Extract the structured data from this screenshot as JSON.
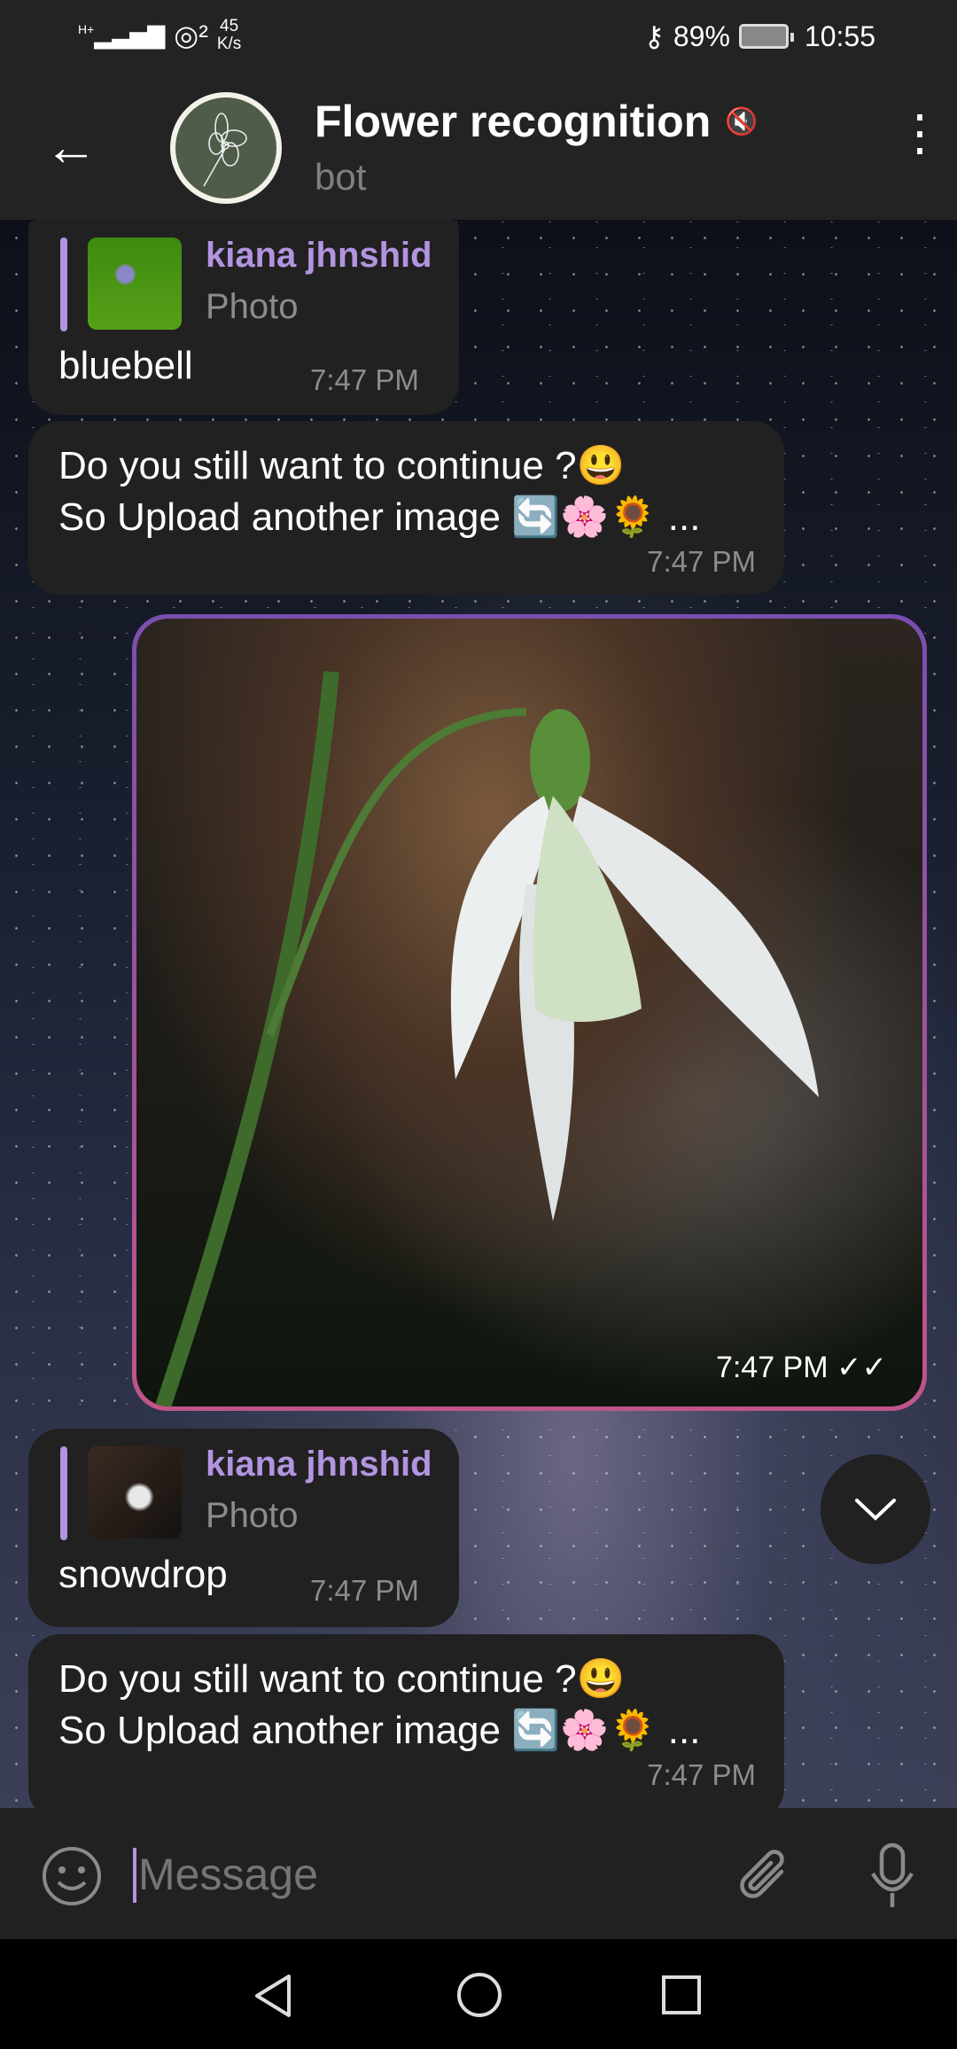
{
  "status_bar": {
    "network": "H+",
    "speed_value": "45",
    "speed_unit": "K/s",
    "battery": "89%",
    "time": "10:55"
  },
  "header": {
    "title": "Flower recognition",
    "subtitle": "bot"
  },
  "messages": [
    {
      "type": "reply",
      "sender": "kiana jhnshid",
      "media": "Photo",
      "text": "bluebell",
      "time": "7:47 PM"
    },
    {
      "type": "bot",
      "line1": "Do you still want to continue ?😃",
      "line2": "So Upload another image 🔄🌸🌻 ...",
      "time": "7:47 PM"
    },
    {
      "type": "photo",
      "time": "7:47 PM"
    },
    {
      "type": "reply",
      "sender": "kiana jhnshid",
      "media": "Photo",
      "text": "snowdrop",
      "time": "7:47 PM"
    },
    {
      "type": "bot",
      "line1": "Do you still want to continue ?😃",
      "line2": "So Upload another image 🔄🌸🌻 ...",
      "time": "7:47 PM"
    }
  ],
  "input": {
    "placeholder": "Message"
  },
  "colors": {
    "accent": "#b394e0",
    "bubble": "#212121",
    "bar": "#232323"
  }
}
